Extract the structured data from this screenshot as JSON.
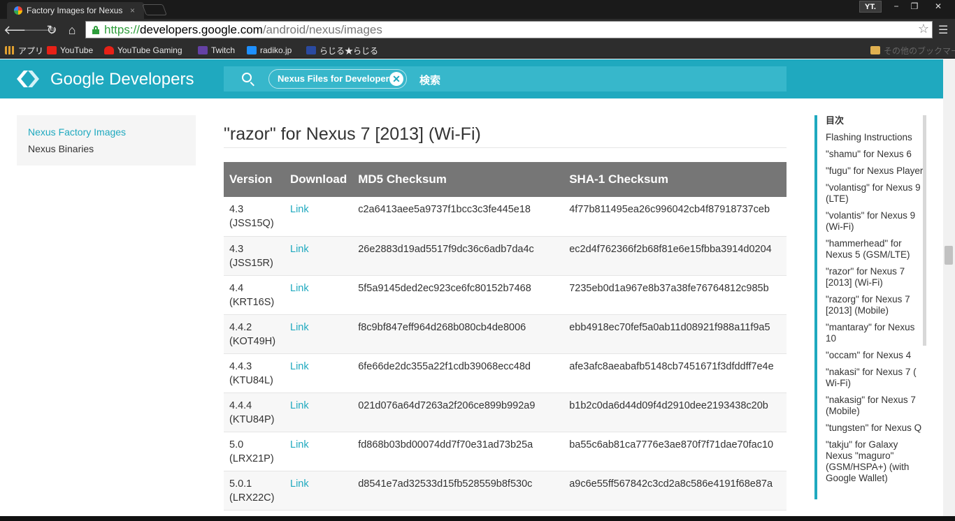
{
  "browser": {
    "tab_title": "Factory Images for Nexus",
    "tab_close": "×",
    "profile": "YT.",
    "window_controls": {
      "minimize": "−",
      "restore": "❐",
      "close": "✕"
    },
    "url_scheme": "https://",
    "url_host": "developers.google.com",
    "url_path": "/android/nexus/images",
    "bookmarks": [
      {
        "label": "アプリ",
        "color": "#e0a030"
      },
      {
        "label": "YouTube",
        "color": "#e62117"
      },
      {
        "label": "YouTube Gaming",
        "color": "#e62117"
      },
      {
        "label": "Twitch",
        "color": "#6441a4"
      },
      {
        "label": "radiko.jp",
        "color": "#1e90ff"
      },
      {
        "label": "らじる★らじる",
        "color": "#2a4aa0"
      }
    ],
    "other_bookmarks": "その他のブックマーク"
  },
  "header": {
    "brand": "Google Developers",
    "search_chip": "Nexus Files for Developers",
    "search_chip_close": "✕",
    "search_placeholder": "検索"
  },
  "sidebar": {
    "items": [
      {
        "label": "Nexus Factory Images"
      },
      {
        "label": "Nexus Binaries"
      }
    ]
  },
  "main": {
    "title": "\"razor\" for Nexus 7 [2013] (Wi-Fi)",
    "table": {
      "headers": [
        "Version",
        "Download",
        "MD5 Checksum",
        "SHA-1 Checksum"
      ],
      "rows": [
        {
          "version": "4.3",
          "build": "(JSS15Q)",
          "download": "Link",
          "md5": "c2a6413aee5a9737f1bcc3c3fe445e18",
          "sha1": "4f77b811495ea26c996042cb4f87918737ceb"
        },
        {
          "version": "4.3",
          "build": "(JSS15R)",
          "download": "Link",
          "md5": "26e2883d19ad5517f9dc36c6adb7da4c",
          "sha1": "ec2d4f762366f2b68f81e6e15fbba3914d0204"
        },
        {
          "version": "4.4",
          "build": "(KRT16S)",
          "download": "Link",
          "md5": "5f5a9145ded2ec923ce6fc80152b7468",
          "sha1": "7235eb0d1a967e8b37a38fe76764812c985b"
        },
        {
          "version": "4.4.2",
          "build": "(KOT49H)",
          "download": "Link",
          "md5": "f8c9bf847eff964d268b080cb4de8006",
          "sha1": "ebb4918ec70fef5a0ab11d08921f988a11f9a5"
        },
        {
          "version": "4.4.3",
          "build": "(KTU84L)",
          "download": "Link",
          "md5": "6fe66de2dc355a22f1cdb39068ecc48d",
          "sha1": "afe3afc8aeabafb5148cb7451671f3dfddff7e4e"
        },
        {
          "version": "4.4.4",
          "build": "(KTU84P)",
          "download": "Link",
          "md5": "021d076a64d7263a2f206ce899b992a9",
          "sha1": "b1b2c0da6d44d09f4d2910dee2193438c20b"
        },
        {
          "version": "5.0",
          "build": "(LRX21P)",
          "download": "Link",
          "md5": "fd868b03bd00074dd7f70e31ad73b25a",
          "sha1": "ba55c6ab81ca7776e3ae870f7f71dae70fac10"
        },
        {
          "version": "5.0.1",
          "build": "(LRX22C)",
          "download": "Link",
          "md5": "d8541e7ad32533d15fb528559b8f530c",
          "sha1": "a9c6e55ff567842c3cd2a8c586e4191f68e87a"
        }
      ]
    }
  },
  "toc": {
    "heading": "目次",
    "items": [
      "Flashing Instructions",
      "\"shamu\" for Nexus 6",
      "\"fugu\" for Nexus Player",
      "\"volantisg\" for Nexus 9 (LTE)",
      "\"volantis\" for Nexus 9 (Wi-Fi)",
      "\"hammerhead\" for Nexus 5 (GSM/LTE)",
      "\"razor\" for Nexus 7 [2013] (Wi-Fi)",
      "\"razorg\" for Nexus 7 [2013] (Mobile)",
      "\"mantaray\" for Nexus 10",
      "\"occam\" for Nexus 4",
      "\"nakasi\" for Nexus 7 ( Wi-Fi)",
      "\"nakasig\" for Nexus 7 (Mobile)",
      "\"tungsten\" for Nexus Q",
      "\"takju\" for Galaxy Nexus \"maguro\" (GSM/HSPA+) (with Google Wallet)"
    ]
  },
  "colors": {
    "brand": "#1fa9bf",
    "table_header": "#767676"
  }
}
